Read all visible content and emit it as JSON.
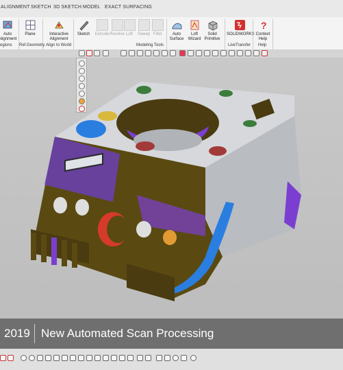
{
  "menu": {
    "tabs": [
      "ALIGNMENT",
      "SKETCH",
      "3D SKETCH",
      "MODEL",
      "EXACT SURFACING"
    ]
  },
  "ribbon": {
    "buttons": {
      "auto_alignment": "Auto Alignment",
      "plane": "Plane",
      "interactive_alignment": "Interactive Alignment",
      "sketch": "Sketch",
      "extrude": "Extrude",
      "revolve": "Revolve",
      "loft": "Loft",
      "sweep": "Sweep",
      "fillet": "Fillet",
      "auto_surface": "Auto Surface",
      "loft_wizard": "Loft Wizard",
      "solid_primitive": "Solid Primitive",
      "solidworks": "SOLIDWORKS",
      "context_help": "Context Help"
    },
    "groups": {
      "regions": "egions",
      "ref_geometry": "Ref.Geometry",
      "align_to_world": "Align to World",
      "modeling_tools": "Modeling Tools",
      "livetransfer": "LiveTransfer",
      "help": "Help"
    }
  },
  "caption": {
    "year": "2019",
    "title": "New Automated Scan Processing"
  },
  "colors": {
    "caption_bg": "#6f6f6f",
    "model_gray": "#d6d8dc",
    "model_purple": "#7a3fd0",
    "model_olive": "#5a4a12",
    "model_blue": "#2a7ee0"
  },
  "icons": [
    "auto-alignment-icon",
    "plane-icon",
    "interactive-alignment-icon",
    "sketch-icon",
    "auto-surface-icon",
    "loft-wizard-icon",
    "solid-primitive-icon",
    "solidworks-logo",
    "context-help-icon"
  ]
}
